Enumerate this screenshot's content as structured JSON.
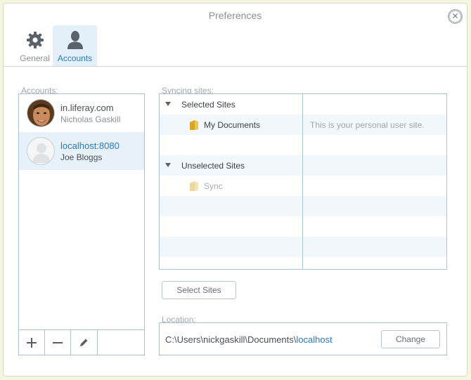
{
  "window": {
    "title": "Preferences"
  },
  "tabs": [
    {
      "label": "General",
      "icon": "gear-icon"
    },
    {
      "label": "Accounts",
      "icon": "person-icon",
      "selected": true
    }
  ],
  "accounts": {
    "label": "Accounts:",
    "items": [
      {
        "host": "in.liferay.com",
        "user": "Nicholas Gaskill",
        "selected": false
      },
      {
        "host": "localhost:8080",
        "user": "Joe Bloggs",
        "selected": true
      }
    ],
    "buttons": [
      "plus-icon",
      "minus-icon",
      "pencil-icon"
    ]
  },
  "syncing": {
    "label": "Syncing sites:",
    "selected_group": "Selected Sites",
    "selected_items": [
      {
        "name": "My Documents",
        "description": "This is your personal user site."
      }
    ],
    "unselected_group": "Unselected Sites",
    "unselected_items": [
      {
        "name": "Sync"
      }
    ],
    "select_button": "Select Sites"
  },
  "location": {
    "label": "Location:",
    "path_prefix": "C:\\Users\\nickgaskill\\Documents\\",
    "path_highlight": "localhost",
    "change_button": "Change"
  },
  "colors": {
    "accent": "#2a7ac0",
    "border": "#a9c4da",
    "selection": "#e6f1fa"
  }
}
